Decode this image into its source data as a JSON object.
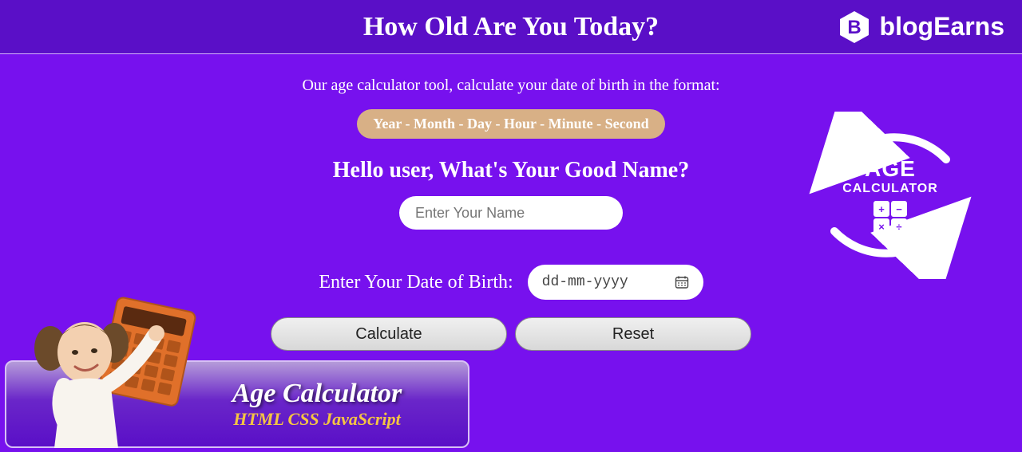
{
  "header": {
    "title": "How Old Are You Today?",
    "logo_text": "blogEarns",
    "logo_letter": "B"
  },
  "main": {
    "subtitle": "Our age calculator tool, calculate your date of birth in the format:",
    "format_pill": "Year - Month - Day - Hour - Minute - Second",
    "name_prompt": "Hello user, What's Your Good Name?",
    "name_placeholder": "Enter Your Name",
    "dob_label": "Enter Your Date of Birth:",
    "dob_placeholder": "dd-mm-yyyy",
    "calculate_label": "Calculate",
    "reset_label": "Reset"
  },
  "badge": {
    "line1": "AGE",
    "line2": "CALCULATOR",
    "ops": [
      "+",
      "−",
      "×",
      "÷"
    ]
  },
  "promo": {
    "title": "Age Calculator",
    "sub": "HTML CSS JavaScript"
  }
}
